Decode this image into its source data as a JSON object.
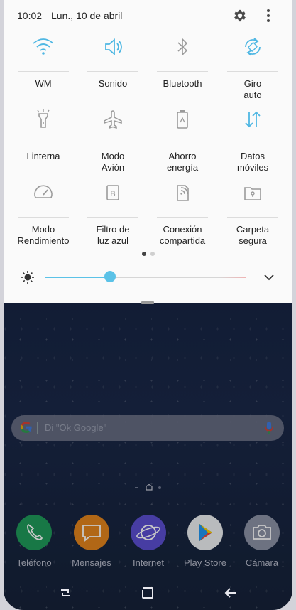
{
  "status": {
    "time": "10:02",
    "date": "Lun., 10 de abril"
  },
  "tiles": [
    {
      "label": "WM",
      "icon": "wifi-icon",
      "active": true
    },
    {
      "label": "Sonido",
      "icon": "speaker-icon",
      "active": true
    },
    {
      "label": "Bluetooth",
      "icon": "bluetooth-icon",
      "active": false
    },
    {
      "label": "Giro\nauto",
      "icon": "auto-rotate-icon",
      "active": true
    },
    {
      "label": "Linterna",
      "icon": "flashlight-icon",
      "active": false
    },
    {
      "label": "Modo\nAvión",
      "icon": "airplane-icon",
      "active": false
    },
    {
      "label": "Ahorro\nenergía",
      "icon": "battery-saver-icon",
      "active": false
    },
    {
      "label": "Datos\nmóviles",
      "icon": "mobile-data-icon",
      "active": true
    },
    {
      "label": "Modo\nRendimiento",
      "icon": "performance-icon",
      "active": false
    },
    {
      "label": "Filtro de\nluz azul",
      "icon": "blue-light-filter-icon",
      "active": false
    },
    {
      "label": "Conexión\ncompartida",
      "icon": "hotspot-icon",
      "active": false
    },
    {
      "label": "Carpeta\nsegura",
      "icon": "secure-folder-icon",
      "active": false
    }
  ],
  "page_indicator": {
    "current": 1,
    "total": 2
  },
  "brightness": {
    "level": 0.32
  },
  "search": {
    "placeholder": "Di \"Ok Google\"",
    "g_letter": "G"
  },
  "dock": [
    {
      "name": "Teléfono",
      "icon": "phone-icon",
      "color": "#1f9a5a"
    },
    {
      "name": "Mensajes",
      "icon": "messages-icon",
      "color": "#e3851d"
    },
    {
      "name": "Internet",
      "icon": "internet-icon",
      "color": "#5b4fd1"
    },
    {
      "name": "Play Store",
      "icon": "play-store-icon",
      "color": "#eef0f2"
    },
    {
      "name": "Cámara",
      "icon": "camera-icon",
      "color": "#8c93a6"
    }
  ],
  "colors": {
    "accent": "#4fb7e3",
    "inactive": "#9a9a9a"
  }
}
